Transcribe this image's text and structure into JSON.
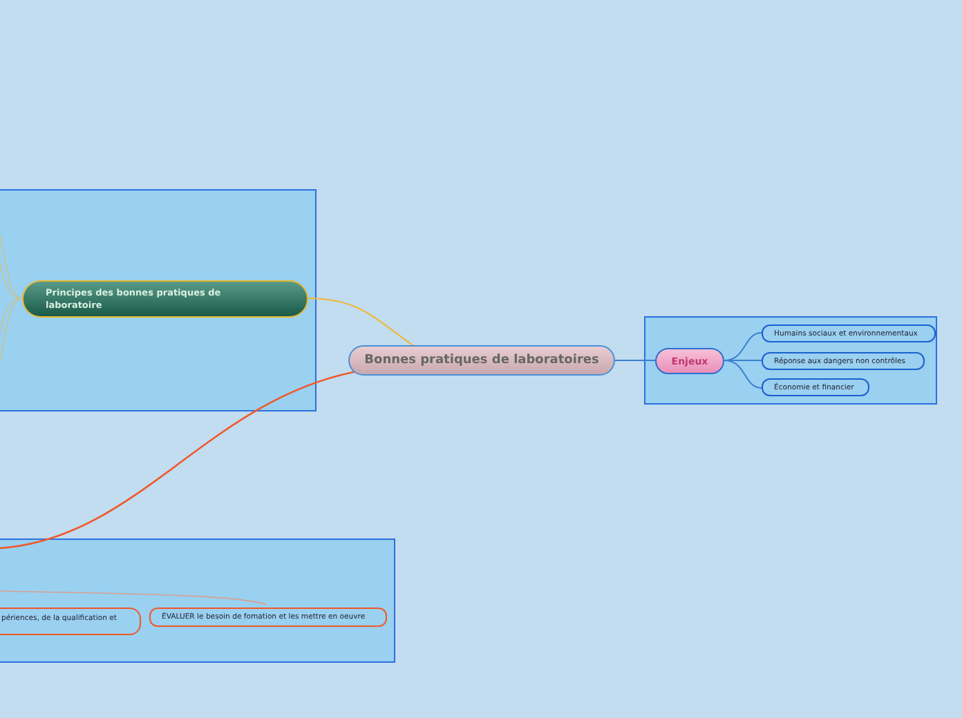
{
  "central": {
    "label": "Bonnes pratiques de laboratoires"
  },
  "branches": [
    {
      "kind": "principes",
      "label": "Principes des bonnes pratiques de laboratoire"
    },
    {
      "kind": "enjeux",
      "label": "Enjeux",
      "children": [
        {
          "label": "Humains sociaux et environnementaux"
        },
        {
          "label": "Réponse aux dangers non contrôles"
        },
        {
          "label": "Économie et financier"
        }
      ]
    },
    {
      "kind": "formation",
      "children": [
        {
          "label": "périences, de la qualification et"
        },
        {
          "label": "ÉVALUER le besoin de fomation et les mettre en oeuvre"
        }
      ]
    }
  ]
}
